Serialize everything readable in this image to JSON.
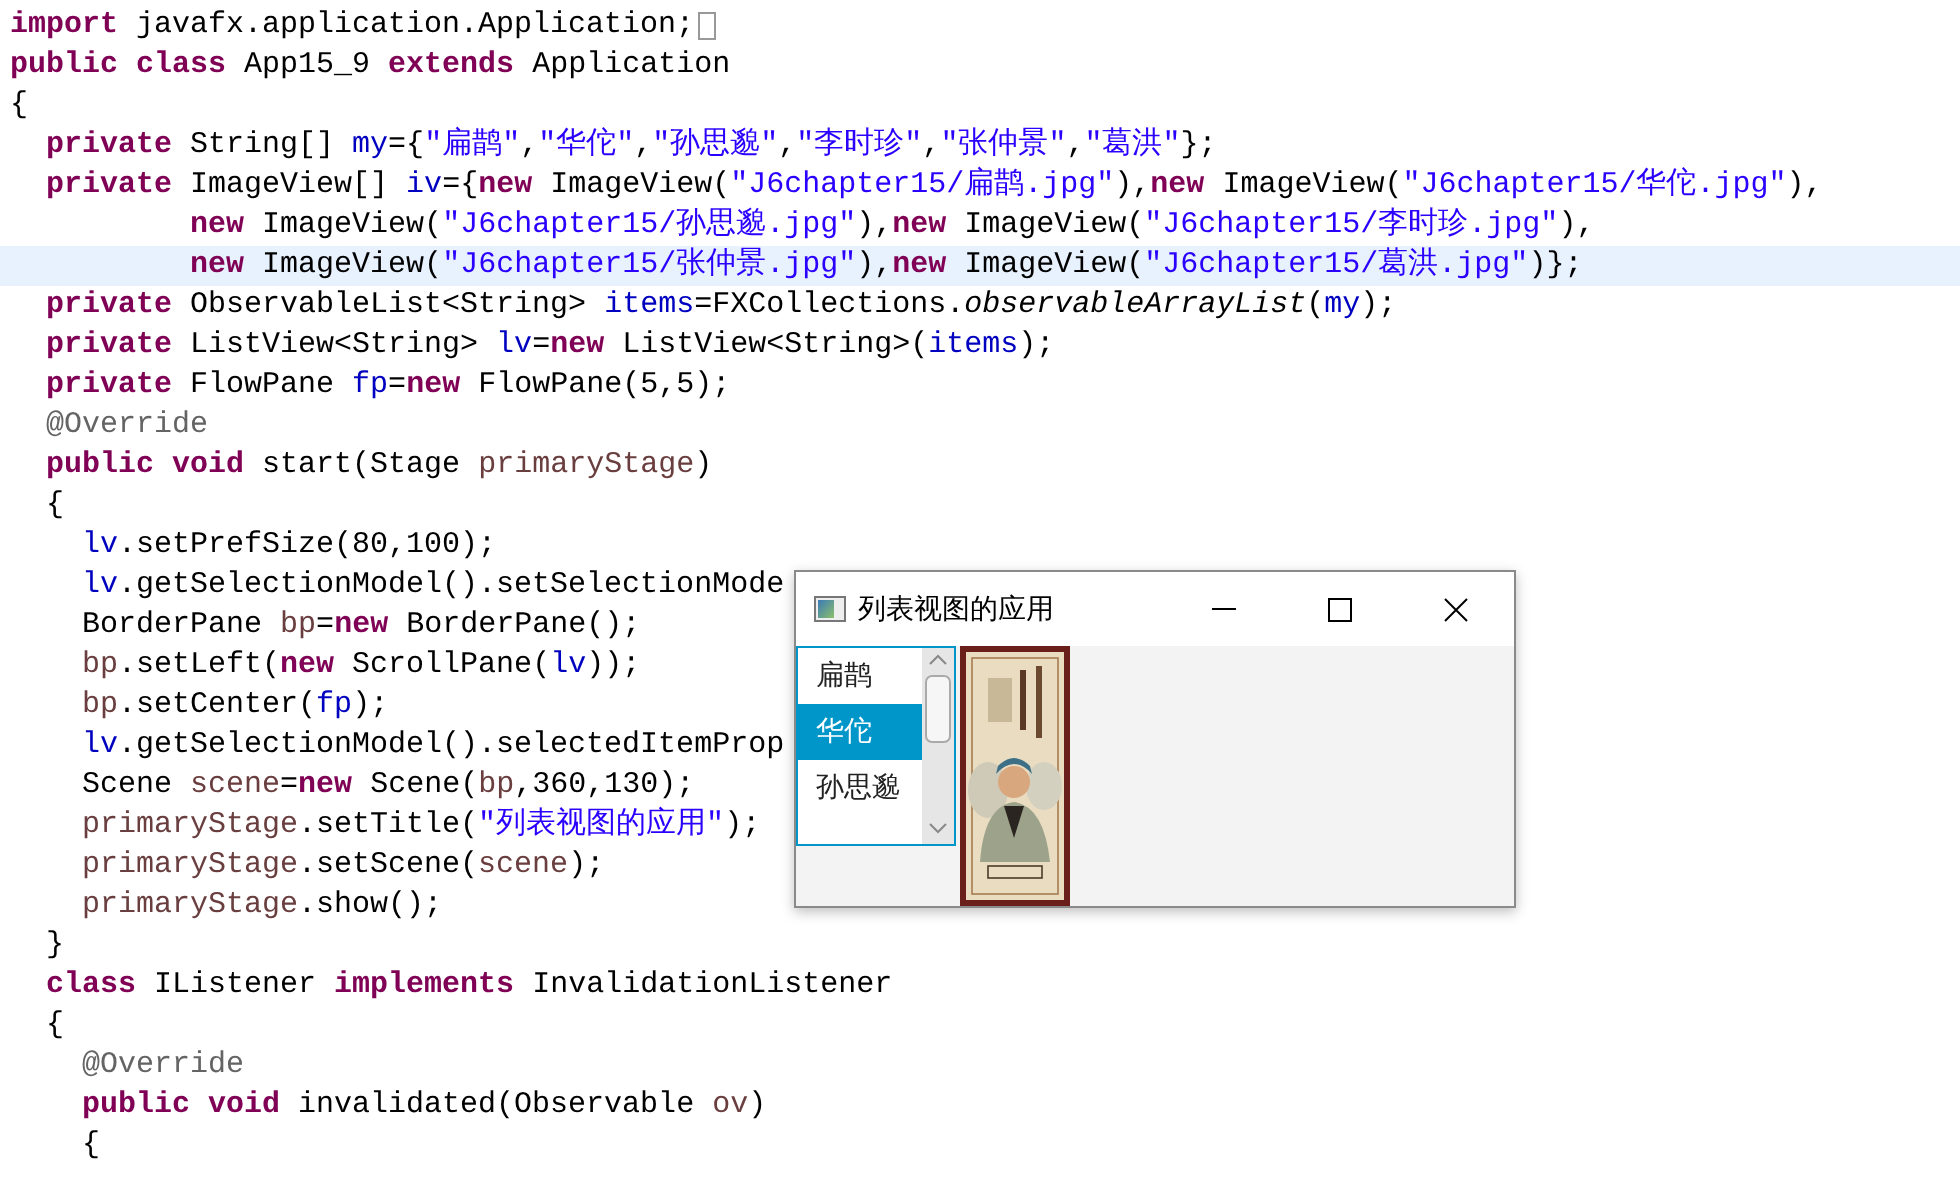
{
  "editor": {
    "lines": [
      {
        "highlighted": false,
        "folded": true,
        "tokens": [
          {
            "kind": "kw",
            "text": "import"
          },
          {
            "kind": "plain",
            "text": " javafx.application.Application;"
          }
        ]
      },
      {
        "highlighted": false,
        "tokens": [
          {
            "kind": "kw",
            "text": "public class"
          },
          {
            "kind": "plain",
            "text": " App15_9 "
          },
          {
            "kind": "kw",
            "text": "extends"
          },
          {
            "kind": "plain",
            "text": " Application"
          }
        ]
      },
      {
        "highlighted": false,
        "tokens": [
          {
            "kind": "plain",
            "text": "{"
          }
        ]
      },
      {
        "highlighted": false,
        "tokens": [
          {
            "kind": "kw",
            "text": "  private"
          },
          {
            "kind": "plain",
            "text": " String[] "
          },
          {
            "kind": "field",
            "text": "my"
          },
          {
            "kind": "plain",
            "text": "={"
          },
          {
            "kind": "str",
            "text": "\"扁鹊\""
          },
          {
            "kind": "plain",
            "text": ","
          },
          {
            "kind": "str",
            "text": "\"华佗\""
          },
          {
            "kind": "plain",
            "text": ","
          },
          {
            "kind": "str",
            "text": "\"孙思邈\""
          },
          {
            "kind": "plain",
            "text": ","
          },
          {
            "kind": "str",
            "text": "\"李时珍\""
          },
          {
            "kind": "plain",
            "text": ","
          },
          {
            "kind": "str",
            "text": "\"张仲景\""
          },
          {
            "kind": "plain",
            "text": ","
          },
          {
            "kind": "str",
            "text": "\"葛洪\""
          },
          {
            "kind": "plain",
            "text": "};"
          }
        ]
      },
      {
        "highlighted": false,
        "tokens": [
          {
            "kind": "kw",
            "text": "  private"
          },
          {
            "kind": "plain",
            "text": " ImageView[] "
          },
          {
            "kind": "field",
            "text": "iv"
          },
          {
            "kind": "plain",
            "text": "={"
          },
          {
            "kind": "kw",
            "text": "new"
          },
          {
            "kind": "plain",
            "text": " ImageView("
          },
          {
            "kind": "str",
            "text": "\"J6chapter15/扁鹊.jpg\""
          },
          {
            "kind": "plain",
            "text": "),"
          },
          {
            "kind": "kw",
            "text": "new"
          },
          {
            "kind": "plain",
            "text": " ImageView("
          },
          {
            "kind": "str",
            "text": "\"J6chapter15/华佗.jpg\""
          },
          {
            "kind": "plain",
            "text": "),"
          }
        ]
      },
      {
        "highlighted": false,
        "tokens": [
          {
            "kind": "kw",
            "text": "          new"
          },
          {
            "kind": "plain",
            "text": " ImageView("
          },
          {
            "kind": "str",
            "text": "\"J6chapter15/孙思邈.jpg\""
          },
          {
            "kind": "plain",
            "text": "),"
          },
          {
            "kind": "kw",
            "text": "new"
          },
          {
            "kind": "plain",
            "text": " ImageView("
          },
          {
            "kind": "str",
            "text": "\"J6chapter15/李时珍.jpg\""
          },
          {
            "kind": "plain",
            "text": "),"
          }
        ]
      },
      {
        "highlighted": true,
        "tokens": [
          {
            "kind": "kw",
            "text": "          new"
          },
          {
            "kind": "plain",
            "text": " ImageView("
          },
          {
            "kind": "str",
            "text": "\"J6chapter15/张仲景.jpg\""
          },
          {
            "kind": "plain",
            "text": "),"
          },
          {
            "kind": "kw",
            "text": "new"
          },
          {
            "kind": "plain",
            "text": " ImageView("
          },
          {
            "kind": "str",
            "text": "\"J6chapter15/葛洪.jpg\""
          },
          {
            "kind": "plain",
            "text": ")};"
          }
        ]
      },
      {
        "highlighted": false,
        "tokens": [
          {
            "kind": "kw",
            "text": "  private"
          },
          {
            "kind": "plain",
            "text": " ObservableList<String> "
          },
          {
            "kind": "field",
            "text": "items"
          },
          {
            "kind": "plain",
            "text": "=FXCollections."
          },
          {
            "kind": "italic",
            "text": "observableArrayList"
          },
          {
            "kind": "plain",
            "text": "("
          },
          {
            "kind": "field",
            "text": "my"
          },
          {
            "kind": "plain",
            "text": ");"
          }
        ]
      },
      {
        "highlighted": false,
        "tokens": [
          {
            "kind": "kw",
            "text": "  private"
          },
          {
            "kind": "plain",
            "text": " ListView<String> "
          },
          {
            "kind": "field",
            "text": "lv"
          },
          {
            "kind": "plain",
            "text": "="
          },
          {
            "kind": "kw",
            "text": "new"
          },
          {
            "kind": "plain",
            "text": " ListView<String>("
          },
          {
            "kind": "field",
            "text": "items"
          },
          {
            "kind": "plain",
            "text": ");"
          }
        ]
      },
      {
        "highlighted": false,
        "tokens": [
          {
            "kind": "kw",
            "text": "  private"
          },
          {
            "kind": "plain",
            "text": " FlowPane "
          },
          {
            "kind": "field",
            "text": "fp"
          },
          {
            "kind": "plain",
            "text": "="
          },
          {
            "kind": "kw",
            "text": "new"
          },
          {
            "kind": "plain",
            "text": " FlowPane(5,5);"
          }
        ]
      },
      {
        "highlighted": false,
        "tokens": [
          {
            "kind": "ann",
            "text": "  @Override"
          }
        ]
      },
      {
        "highlighted": false,
        "tokens": [
          {
            "kind": "kw",
            "text": "  public void"
          },
          {
            "kind": "plain",
            "text": " start(Stage "
          },
          {
            "kind": "param",
            "text": "primaryStage"
          },
          {
            "kind": "plain",
            "text": ")"
          }
        ]
      },
      {
        "highlighted": false,
        "tokens": [
          {
            "kind": "plain",
            "text": "  {"
          }
        ]
      },
      {
        "highlighted": false,
        "tokens": [
          {
            "kind": "field",
            "text": "    lv"
          },
          {
            "kind": "plain",
            "text": ".setPrefSize(80,100);"
          }
        ]
      },
      {
        "highlighted": false,
        "tokens": [
          {
            "kind": "field",
            "text": "    lv"
          },
          {
            "kind": "plain",
            "text": ".getSelectionModel().setSelectionMode"
          }
        ]
      },
      {
        "highlighted": false,
        "tokens": [
          {
            "kind": "plain",
            "text": "    BorderPane "
          },
          {
            "kind": "param",
            "text": "bp"
          },
          {
            "kind": "plain",
            "text": "="
          },
          {
            "kind": "kw",
            "text": "new"
          },
          {
            "kind": "plain",
            "text": " BorderPane();"
          }
        ]
      },
      {
        "highlighted": false,
        "tokens": [
          {
            "kind": "param",
            "text": "    bp"
          },
          {
            "kind": "plain",
            "text": ".setLeft("
          },
          {
            "kind": "kw",
            "text": "new"
          },
          {
            "kind": "plain",
            "text": " ScrollPane("
          },
          {
            "kind": "field",
            "text": "lv"
          },
          {
            "kind": "plain",
            "text": "));"
          }
        ]
      },
      {
        "highlighted": false,
        "tokens": [
          {
            "kind": "param",
            "text": "    bp"
          },
          {
            "kind": "plain",
            "text": ".setCenter("
          },
          {
            "kind": "field",
            "text": "fp"
          },
          {
            "kind": "plain",
            "text": ");"
          }
        ]
      },
      {
        "highlighted": false,
        "tokens": [
          {
            "kind": "field",
            "text": "    lv"
          },
          {
            "kind": "plain",
            "text": ".getSelectionModel().selectedItemProp"
          }
        ]
      },
      {
        "highlighted": false,
        "tokens": [
          {
            "kind": "plain",
            "text": "    Scene "
          },
          {
            "kind": "param",
            "text": "scene"
          },
          {
            "kind": "plain",
            "text": "="
          },
          {
            "kind": "kw",
            "text": "new"
          },
          {
            "kind": "plain",
            "text": " Scene("
          },
          {
            "kind": "param",
            "text": "bp"
          },
          {
            "kind": "plain",
            "text": ",360,130);"
          }
        ]
      },
      {
        "highlighted": false,
        "tokens": [
          {
            "kind": "param",
            "text": "    primaryStage"
          },
          {
            "kind": "plain",
            "text": ".setTitle("
          },
          {
            "kind": "str",
            "text": "\"列表视图的应用\""
          },
          {
            "kind": "plain",
            "text": ");"
          }
        ]
      },
      {
        "highlighted": false,
        "tokens": [
          {
            "kind": "param",
            "text": "    primaryStage"
          },
          {
            "kind": "plain",
            "text": ".setScene("
          },
          {
            "kind": "param",
            "text": "scene"
          },
          {
            "kind": "plain",
            "text": ");"
          }
        ]
      },
      {
        "highlighted": false,
        "tokens": [
          {
            "kind": "param",
            "text": "    primaryStage"
          },
          {
            "kind": "plain",
            "text": ".show();"
          }
        ]
      },
      {
        "highlighted": false,
        "tokens": [
          {
            "kind": "plain",
            "text": "  }"
          }
        ]
      },
      {
        "highlighted": false,
        "tokens": [
          {
            "kind": "kw",
            "text": "  class"
          },
          {
            "kind": "plain",
            "text": " IListener "
          },
          {
            "kind": "kw",
            "text": "implements"
          },
          {
            "kind": "plain",
            "text": " InvalidationListener"
          }
        ]
      },
      {
        "highlighted": false,
        "tokens": [
          {
            "kind": "plain",
            "text": "  {"
          }
        ]
      },
      {
        "highlighted": false,
        "tokens": [
          {
            "kind": "ann",
            "text": "    @Override"
          }
        ]
      },
      {
        "highlighted": false,
        "tokens": [
          {
            "kind": "kw",
            "text": "    public void"
          },
          {
            "kind": "plain",
            "text": " invalidated(Observable "
          },
          {
            "kind": "param",
            "text": "ov"
          },
          {
            "kind": "plain",
            "text": ")"
          }
        ]
      },
      {
        "highlighted": false,
        "tokens": [
          {
            "kind": "plain",
            "text": "    {"
          }
        ]
      }
    ]
  },
  "window": {
    "title": "列表视图的应用",
    "list_items": [
      {
        "label": "扁鹊",
        "selected": false
      },
      {
        "label": "华佗",
        "selected": true
      },
      {
        "label": "孙思邈",
        "selected": false
      }
    ]
  }
}
